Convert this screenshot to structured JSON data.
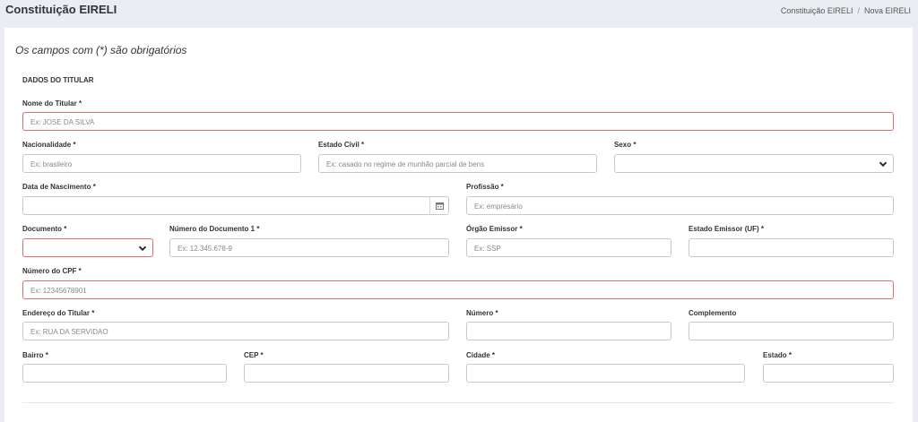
{
  "header": {
    "title": "Constituição EIRELI",
    "breadcrumb": [
      "Constituição EIRELI",
      "Nova EIRELI"
    ],
    "separator": "/"
  },
  "form": {
    "required_note": "Os campos com (*) são obrigatórios",
    "section_title": "DADOS DO TITULAR",
    "fields": {
      "nome_titular": {
        "label": "Nome do Titular *",
        "placeholder": "Ex: JOSE DA SILVA"
      },
      "nacionalidade": {
        "label": "Nacionalidade *",
        "placeholder": "Ex: brasileiro"
      },
      "estado_civil": {
        "label": "Estado Civil *",
        "placeholder": "Ex: casado no regime de munhão parcial de bens"
      },
      "sexo": {
        "label": "Sexo *",
        "value": ""
      },
      "data_nascimento": {
        "label": "Data de Nascimento *",
        "value": ""
      },
      "profissao": {
        "label": "Profissão *",
        "placeholder": "Ex: empresário"
      },
      "documento": {
        "label": "Documento *",
        "value": ""
      },
      "numero_documento": {
        "label": "Número do Documento 1 *",
        "placeholder": "Ex: 12.345.678-9"
      },
      "orgao_emissor": {
        "label": "Órgão Emissor *",
        "placeholder": "Ex: SSP"
      },
      "estado_emissor": {
        "label": "Estado Emissor (UF) *",
        "value": ""
      },
      "cpf": {
        "label": "Número do CPF *",
        "placeholder": "Ex: 12345678901"
      },
      "endereco": {
        "label": "Endereço do Titular *",
        "placeholder": "Ex: RUA DA SERVIDAO"
      },
      "numero": {
        "label": "Número *",
        "value": ""
      },
      "complemento": {
        "label": "Complemento",
        "value": ""
      },
      "bairro": {
        "label": "Bairro *",
        "value": ""
      },
      "cep": {
        "label": "CEP *",
        "value": ""
      },
      "cidade": {
        "label": "Cidade *",
        "value": ""
      },
      "estado": {
        "label": "Estado *",
        "value": ""
      }
    }
  },
  "colors": {
    "error_border": "#e06c6c",
    "background": "#ebedf2"
  },
  "icons": {
    "select": "chevron-down-icon",
    "date": "calendar-icon"
  }
}
